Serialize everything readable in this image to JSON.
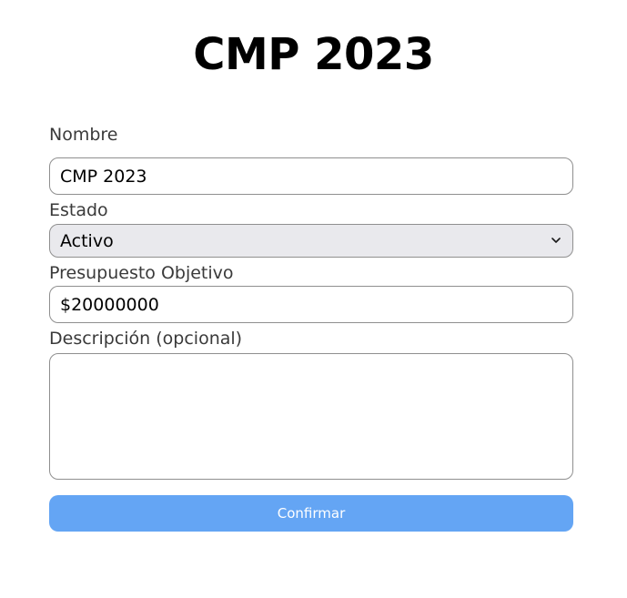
{
  "page_title": "CMP 2023",
  "form": {
    "nombre": {
      "label": "Nombre",
      "value": "CMP 2023"
    },
    "estado": {
      "label": "Estado",
      "selected": "Activo"
    },
    "presupuesto": {
      "label": "Presupuesto Objetivo",
      "value": "$20000000"
    },
    "descripcion": {
      "label": "Descripción (opcional)",
      "value": ""
    },
    "submit_label": "Confirmar"
  },
  "colors": {
    "button": "#64a5f4",
    "select_bg": "#e9e9ed",
    "border": "#8f8f8f"
  },
  "icons": {
    "select_arrow": "chevron-down-icon"
  }
}
